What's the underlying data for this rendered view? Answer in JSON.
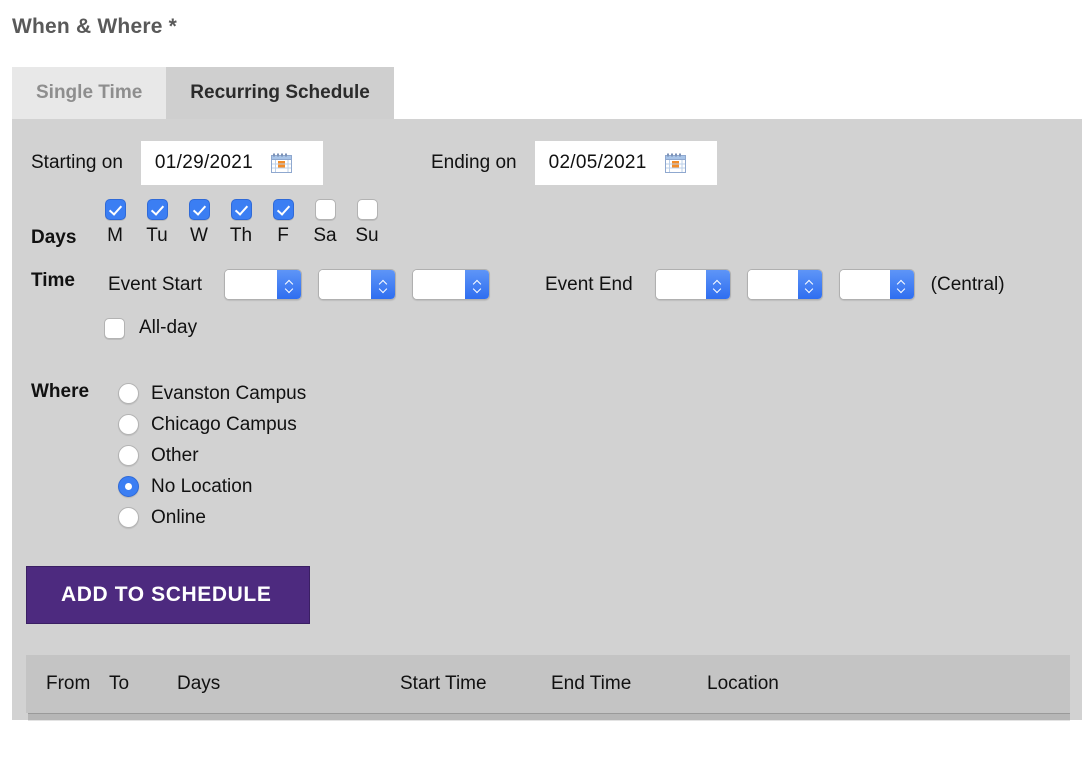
{
  "heading": "When & Where *",
  "tabs": [
    {
      "label": "Single Time",
      "active": false
    },
    {
      "label": "Recurring Schedule",
      "active": true
    }
  ],
  "dates": {
    "start_label": "Starting on",
    "start_value": "01/29/2021",
    "end_label": "Ending on",
    "end_value": "02/05/2021",
    "calendar_icon": "calendar-icon"
  },
  "days": {
    "label": "Days",
    "items": [
      {
        "label": "M",
        "checked": true
      },
      {
        "label": "Tu",
        "checked": true
      },
      {
        "label": "W",
        "checked": true
      },
      {
        "label": "Th",
        "checked": true
      },
      {
        "label": "F",
        "checked": true
      },
      {
        "label": "Sa",
        "checked": false
      },
      {
        "label": "Su",
        "checked": false
      }
    ]
  },
  "time": {
    "label": "Time",
    "start_label": "Event Start",
    "end_label": "Event End",
    "timezone": "(Central)",
    "start_selects": [
      "",
      "",
      ""
    ],
    "end_selects": [
      "",
      "",
      ""
    ],
    "allday_label": "All-day",
    "allday_checked": false
  },
  "where": {
    "label": "Where",
    "options": [
      {
        "label": "Evanston Campus",
        "selected": false
      },
      {
        "label": "Chicago Campus",
        "selected": false
      },
      {
        "label": "Other",
        "selected": false
      },
      {
        "label": "No Location",
        "selected": true
      },
      {
        "label": "Online",
        "selected": false
      }
    ]
  },
  "actions": {
    "add_to_schedule": "ADD TO SCHEDULE"
  },
  "schedule_table": {
    "columns": [
      "From",
      "To",
      "Days",
      "Start Time",
      "End Time",
      "Location"
    ],
    "rows": []
  },
  "colors": {
    "brand_purple": "#4d2a7f",
    "accent_blue": "#3b7ef3",
    "panel_gray": "#d2d2d2",
    "active_tab_gray": "#cfcfcf",
    "inactive_tab_gray": "#e8e8e8",
    "table_header_gray": "#c4c4c4"
  }
}
